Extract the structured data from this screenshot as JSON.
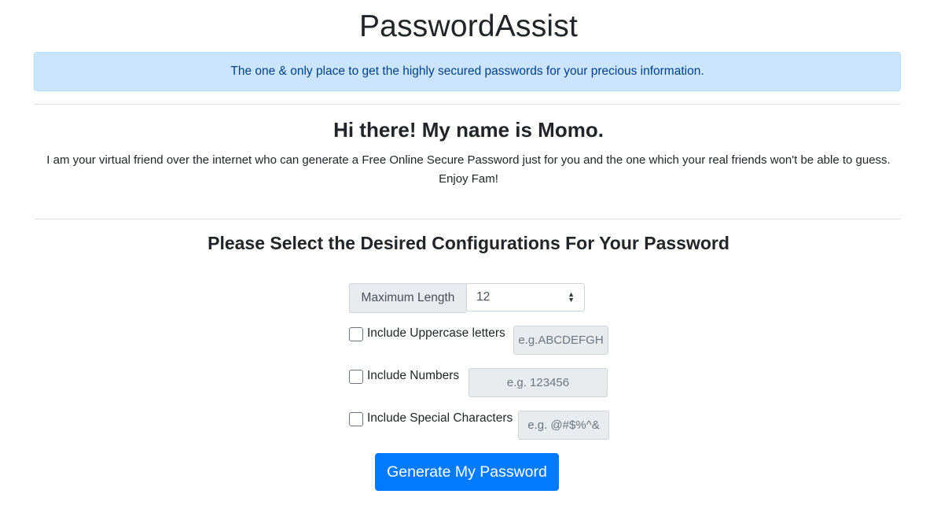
{
  "app": {
    "title": "PasswordAssist",
    "banner": "The one & only place to get the highly secured passwords for your precious information."
  },
  "intro": {
    "heading": "Hi there! My name is Momo.",
    "line1": "I am your virtual friend over the internet who can generate a Free Online Secure Password just for you and the one which your real friends won't be able to guess.",
    "line2": "Enjoy Fam!"
  },
  "config": {
    "heading": "Please Select the Desired Configurations For Your Password",
    "length_label": "Maximum Length",
    "length_value": "12",
    "options": [
      {
        "label": "Include Uppercase letters",
        "example": "e.g.ABCDEFGH",
        "checked": false
      },
      {
        "label": "Include Numbers",
        "example": "e.g. 123456",
        "checked": false
      },
      {
        "label": "Include Special Characters",
        "example": "e.g. @#$%^&",
        "checked": false
      }
    ],
    "generate_label": "Generate My Password"
  },
  "colors": {
    "banner_bg": "#cce5ff",
    "banner_text": "#004085",
    "primary": "#007bff",
    "addon_bg": "#e9ecef"
  }
}
